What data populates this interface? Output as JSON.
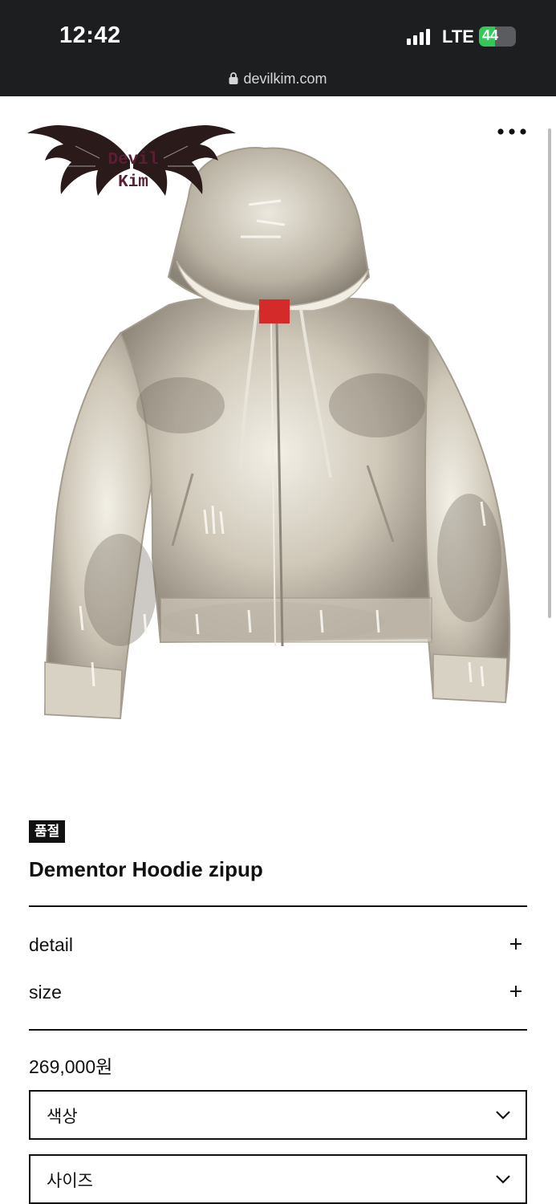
{
  "status_bar": {
    "time": "12:42",
    "network": "LTE",
    "battery_percent": "44",
    "battery_level": 0.44,
    "battery_color": "#34c759",
    "url": "devilkim.com"
  },
  "header": {
    "logo_text_line1": "Devil",
    "logo_text_line2": "Kim",
    "logo_icon": "bat-wings-logo",
    "menu_icon": "more-icon"
  },
  "product": {
    "image_icon": "distressed-zip-hoodie-photo",
    "badge": "품절",
    "title": "Dementor Hoodie zipup",
    "accordion": [
      {
        "label": "detail",
        "icon": "plus-icon"
      },
      {
        "label": "size",
        "icon": "plus-icon"
      }
    ],
    "price": "269,000원",
    "options": [
      {
        "label": "색상",
        "icon": "chevron-down-icon"
      },
      {
        "label": "사이즈",
        "icon": "chevron-down-icon"
      }
    ]
  }
}
